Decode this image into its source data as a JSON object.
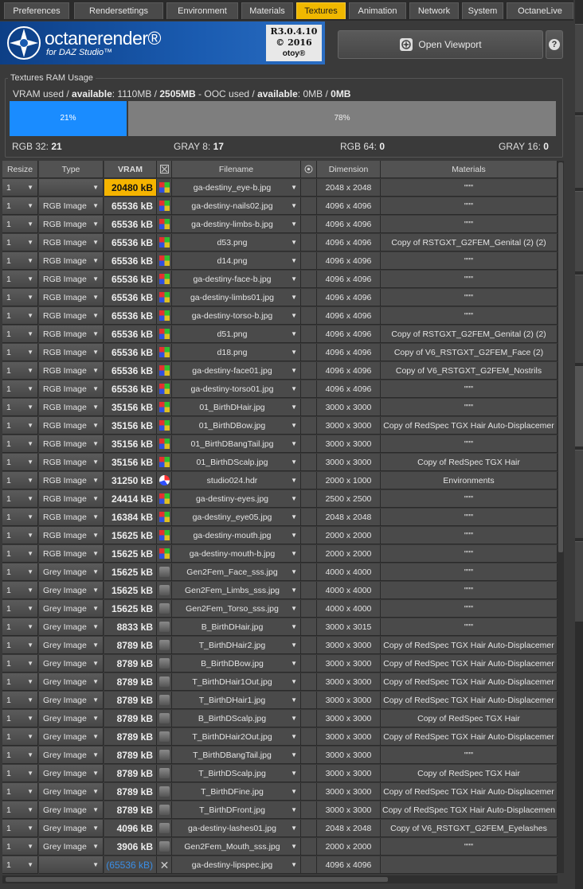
{
  "tabs": [
    {
      "label": "Preferences",
      "active": false
    },
    {
      "label": "Rendersettings",
      "active": false
    },
    {
      "label": "Environment",
      "active": false
    },
    {
      "label": "Materials",
      "active": false
    },
    {
      "label": "Textures",
      "active": true
    },
    {
      "label": "Animation",
      "active": false
    },
    {
      "label": "Network",
      "active": false
    },
    {
      "label": "System",
      "active": false
    },
    {
      "label": "OctaneLive",
      "active": false
    }
  ],
  "header": {
    "logo_title": "octanerender®",
    "logo_subtitle": "for DAZ Studio™",
    "version": "R3.0.4.10",
    "copyright": "© 2016",
    "brand": "otoy®",
    "open_viewport_label": "Open Viewport"
  },
  "ram": {
    "title": "Textures RAM Usage",
    "vram_used_label": "VRAM used /",
    "available_label": "available",
    "vram_values": ": 1110MB /",
    "vram_total": "2505MB",
    "ooc_label": "- OOC used /",
    "available_label2": "available",
    "ooc_values": ": 0MB /",
    "ooc_total": "0MB",
    "used_percent": "21%",
    "free_percent": "78%",
    "used_fraction": 0.21,
    "counts": {
      "rgb32_label": "RGB 32:",
      "rgb32": "21",
      "gray8_label": "GRAY 8:",
      "gray8": "17",
      "rgb64_label": "RGB 64:",
      "rgb64": "0",
      "gray16_label": "GRAY 16:",
      "gray16": "0"
    }
  },
  "table": {
    "headers": {
      "resize": "Resize",
      "type": "Type",
      "vram": "VRAM",
      "filename": "Filename",
      "dimension": "Dimension",
      "materials": "Materials"
    },
    "rows": [
      {
        "resize": "1",
        "type": "",
        "vram": "20480 kB",
        "icon": "rgb",
        "filename": "ga-destiny_eye-b.jpg",
        "dimension": "2048 x 2048",
        "materials": "\"\"\""
      },
      {
        "resize": "1",
        "type": "RGB Image",
        "vram": "65536 kB",
        "icon": "rgb",
        "filename": "ga-destiny-nails02.jpg",
        "dimension": "4096 x 4096",
        "materials": "\"\"\""
      },
      {
        "resize": "1",
        "type": "RGB Image",
        "vram": "65536 kB",
        "icon": "rgb",
        "filename": "ga-destiny-limbs-b.jpg",
        "dimension": "4096 x 4096",
        "materials": "\"\"\""
      },
      {
        "resize": "1",
        "type": "RGB Image",
        "vram": "65536 kB",
        "icon": "rgb",
        "filename": "d53.png",
        "dimension": "4096 x 4096",
        "materials": "Copy of RSTGXT_G2FEM_Genital (2) (2)"
      },
      {
        "resize": "1",
        "type": "RGB Image",
        "vram": "65536 kB",
        "icon": "rgb",
        "filename": "d14.png",
        "dimension": "4096 x 4096",
        "materials": "\"\"\""
      },
      {
        "resize": "1",
        "type": "RGB Image",
        "vram": "65536 kB",
        "icon": "rgb",
        "filename": "ga-destiny-face-b.jpg",
        "dimension": "4096 x 4096",
        "materials": "\"\"\""
      },
      {
        "resize": "1",
        "type": "RGB Image",
        "vram": "65536 kB",
        "icon": "rgb",
        "filename": "ga-destiny-limbs01.jpg",
        "dimension": "4096 x 4096",
        "materials": "\"\"\""
      },
      {
        "resize": "1",
        "type": "RGB Image",
        "vram": "65536 kB",
        "icon": "rgb",
        "filename": "ga-destiny-torso-b.jpg",
        "dimension": "4096 x 4096",
        "materials": "\"\"\""
      },
      {
        "resize": "1",
        "type": "RGB Image",
        "vram": "65536 kB",
        "icon": "rgb",
        "filename": "d51.png",
        "dimension": "4096 x 4096",
        "materials": "Copy of RSTGXT_G2FEM_Genital (2) (2)"
      },
      {
        "resize": "1",
        "type": "RGB Image",
        "vram": "65536 kB",
        "icon": "rgb",
        "filename": "d18.png",
        "dimension": "4096 x 4096",
        "materials": "Copy of V6_RSTGXT_G2FEM_Face (2)"
      },
      {
        "resize": "1",
        "type": "RGB Image",
        "vram": "65536 kB",
        "icon": "rgb",
        "filename": "ga-destiny-face01.jpg",
        "dimension": "4096 x 4096",
        "materials": "Copy of V6_RSTGXT_G2FEM_Nostrils"
      },
      {
        "resize": "1",
        "type": "RGB Image",
        "vram": "65536 kB",
        "icon": "rgb",
        "filename": "ga-destiny-torso01.jpg",
        "dimension": "4096 x 4096",
        "materials": "\"\"\""
      },
      {
        "resize": "1",
        "type": "RGB Image",
        "vram": "35156 kB",
        "icon": "rgb",
        "filename": "01_BirthDHair.jpg",
        "dimension": "3000 x 3000",
        "materials": "\"\"\""
      },
      {
        "resize": "1",
        "type": "RGB Image",
        "vram": "35156 kB",
        "icon": "rgb",
        "filename": "01_BirthDBow.jpg",
        "dimension": "3000 x 3000",
        "materials": "Copy of RedSpec TGX Hair Auto-Displacemer"
      },
      {
        "resize": "1",
        "type": "RGB Image",
        "vram": "35156 kB",
        "icon": "rgb",
        "filename": "01_BirthDBangTail.jpg",
        "dimension": "3000 x 3000",
        "materials": "\"\"\""
      },
      {
        "resize": "1",
        "type": "RGB Image",
        "vram": "35156 kB",
        "icon": "rgb",
        "filename": "01_BirthDScalp.jpg",
        "dimension": "3000 x 3000",
        "materials": "Copy of RedSpec TGX Hair"
      },
      {
        "resize": "1",
        "type": "RGB Image",
        "vram": "31250 kB",
        "icon": "hdr",
        "filename": "studio024.hdr",
        "dimension": "2000 x 1000",
        "materials": "Environments"
      },
      {
        "resize": "1",
        "type": "RGB Image",
        "vram": "24414 kB",
        "icon": "rgb",
        "filename": "ga-destiny-eyes.jpg",
        "dimension": "2500 x 2500",
        "materials": "\"\"\""
      },
      {
        "resize": "1",
        "type": "RGB Image",
        "vram": "16384 kB",
        "icon": "rgb",
        "filename": "ga-destiny_eye05.jpg",
        "dimension": "2048 x 2048",
        "materials": "\"\"\""
      },
      {
        "resize": "1",
        "type": "RGB Image",
        "vram": "15625 kB",
        "icon": "rgb",
        "filename": "ga-destiny-mouth.jpg",
        "dimension": "2000 x 2000",
        "materials": "\"\"\""
      },
      {
        "resize": "1",
        "type": "RGB Image",
        "vram": "15625 kB",
        "icon": "rgb",
        "filename": "ga-destiny-mouth-b.jpg",
        "dimension": "2000 x 2000",
        "materials": "\"\"\""
      },
      {
        "resize": "1",
        "type": "Grey Image",
        "vram": "15625 kB",
        "icon": "grey",
        "filename": "Gen2Fem_Face_sss.jpg",
        "dimension": "4000 x 4000",
        "materials": "\"\"\""
      },
      {
        "resize": "1",
        "type": "Grey Image",
        "vram": "15625 kB",
        "icon": "grey",
        "filename": "Gen2Fem_Limbs_sss.jpg",
        "dimension": "4000 x 4000",
        "materials": "\"\"\""
      },
      {
        "resize": "1",
        "type": "Grey Image",
        "vram": "15625 kB",
        "icon": "grey",
        "filename": "Gen2Fem_Torso_sss.jpg",
        "dimension": "4000 x 4000",
        "materials": "\"\"\""
      },
      {
        "resize": "1",
        "type": "Grey Image",
        "vram": "8833 kB",
        "icon": "grey",
        "filename": "B_BirthDHair.jpg",
        "dimension": "3000 x 3015",
        "materials": "\"\"\""
      },
      {
        "resize": "1",
        "type": "Grey Image",
        "vram": "8789 kB",
        "icon": "grey",
        "filename": "T_BirthDHair2.jpg",
        "dimension": "3000 x 3000",
        "materials": "Copy of RedSpec TGX Hair Auto-Displacemer"
      },
      {
        "resize": "1",
        "type": "Grey Image",
        "vram": "8789 kB",
        "icon": "grey",
        "filename": "B_BirthDBow.jpg",
        "dimension": "3000 x 3000",
        "materials": "Copy of RedSpec TGX Hair Auto-Displacemer"
      },
      {
        "resize": "1",
        "type": "Grey Image",
        "vram": "8789 kB",
        "icon": "grey",
        "filename": "T_BirthDHair1Out.jpg",
        "dimension": "3000 x 3000",
        "materials": "Copy of RedSpec TGX Hair Auto-Displacemer"
      },
      {
        "resize": "1",
        "type": "Grey Image",
        "vram": "8789 kB",
        "icon": "grey",
        "filename": "T_BirthDHair1.jpg",
        "dimension": "3000 x 3000",
        "materials": "Copy of RedSpec TGX Hair Auto-Displacemer"
      },
      {
        "resize": "1",
        "type": "Grey Image",
        "vram": "8789 kB",
        "icon": "grey",
        "filename": "B_BirthDScalp.jpg",
        "dimension": "3000 x 3000",
        "materials": "Copy of RedSpec TGX Hair"
      },
      {
        "resize": "1",
        "type": "Grey Image",
        "vram": "8789 kB",
        "icon": "grey",
        "filename": "T_BirthDHair2Out.jpg",
        "dimension": "3000 x 3000",
        "materials": "Copy of RedSpec TGX Hair Auto-Displacemer"
      },
      {
        "resize": "1",
        "type": "Grey Image",
        "vram": "8789 kB",
        "icon": "grey",
        "filename": "T_BirthDBangTail.jpg",
        "dimension": "3000 x 3000",
        "materials": "\"\"\""
      },
      {
        "resize": "1",
        "type": "Grey Image",
        "vram": "8789 kB",
        "icon": "grey",
        "filename": "T_BirthDScalp.jpg",
        "dimension": "3000 x 3000",
        "materials": "Copy of RedSpec TGX Hair"
      },
      {
        "resize": "1",
        "type": "Grey Image",
        "vram": "8789 kB",
        "icon": "grey",
        "filename": "T_BirthDFine.jpg",
        "dimension": "3000 x 3000",
        "materials": "Copy of RedSpec TGX Hair Auto-Displacemer"
      },
      {
        "resize": "1",
        "type": "Grey Image",
        "vram": "8789 kB",
        "icon": "grey",
        "filename": "T_BirthDFront.jpg",
        "dimension": "3000 x 3000",
        "materials": "Copy of RedSpec TGX Hair Auto-Displacemen"
      },
      {
        "resize": "1",
        "type": "Grey Image",
        "vram": "4096 kB",
        "icon": "grey",
        "filename": "ga-destiny-lashes01.jpg",
        "dimension": "2048 x 2048",
        "materials": "Copy of V6_RSTGXT_G2FEM_Eyelashes"
      },
      {
        "resize": "1",
        "type": "Grey Image",
        "vram": "3906 kB",
        "icon": "grey",
        "filename": "Gen2Fem_Mouth_sss.jpg",
        "dimension": "2000 x 2000",
        "materials": "\"\"\""
      },
      {
        "resize": "1",
        "type": "",
        "vram": "(65536 kB)",
        "icon": "x",
        "filename": "ga-destiny-lipspec.jpg",
        "dimension": "4096 x 4096",
        "materials": ""
      }
    ]
  },
  "colors": {
    "accent": "#f0b800",
    "bar_used": "#1a8cff",
    "bar_free": "#7e7e7e",
    "vram_unloaded": "#3a8ee6"
  }
}
